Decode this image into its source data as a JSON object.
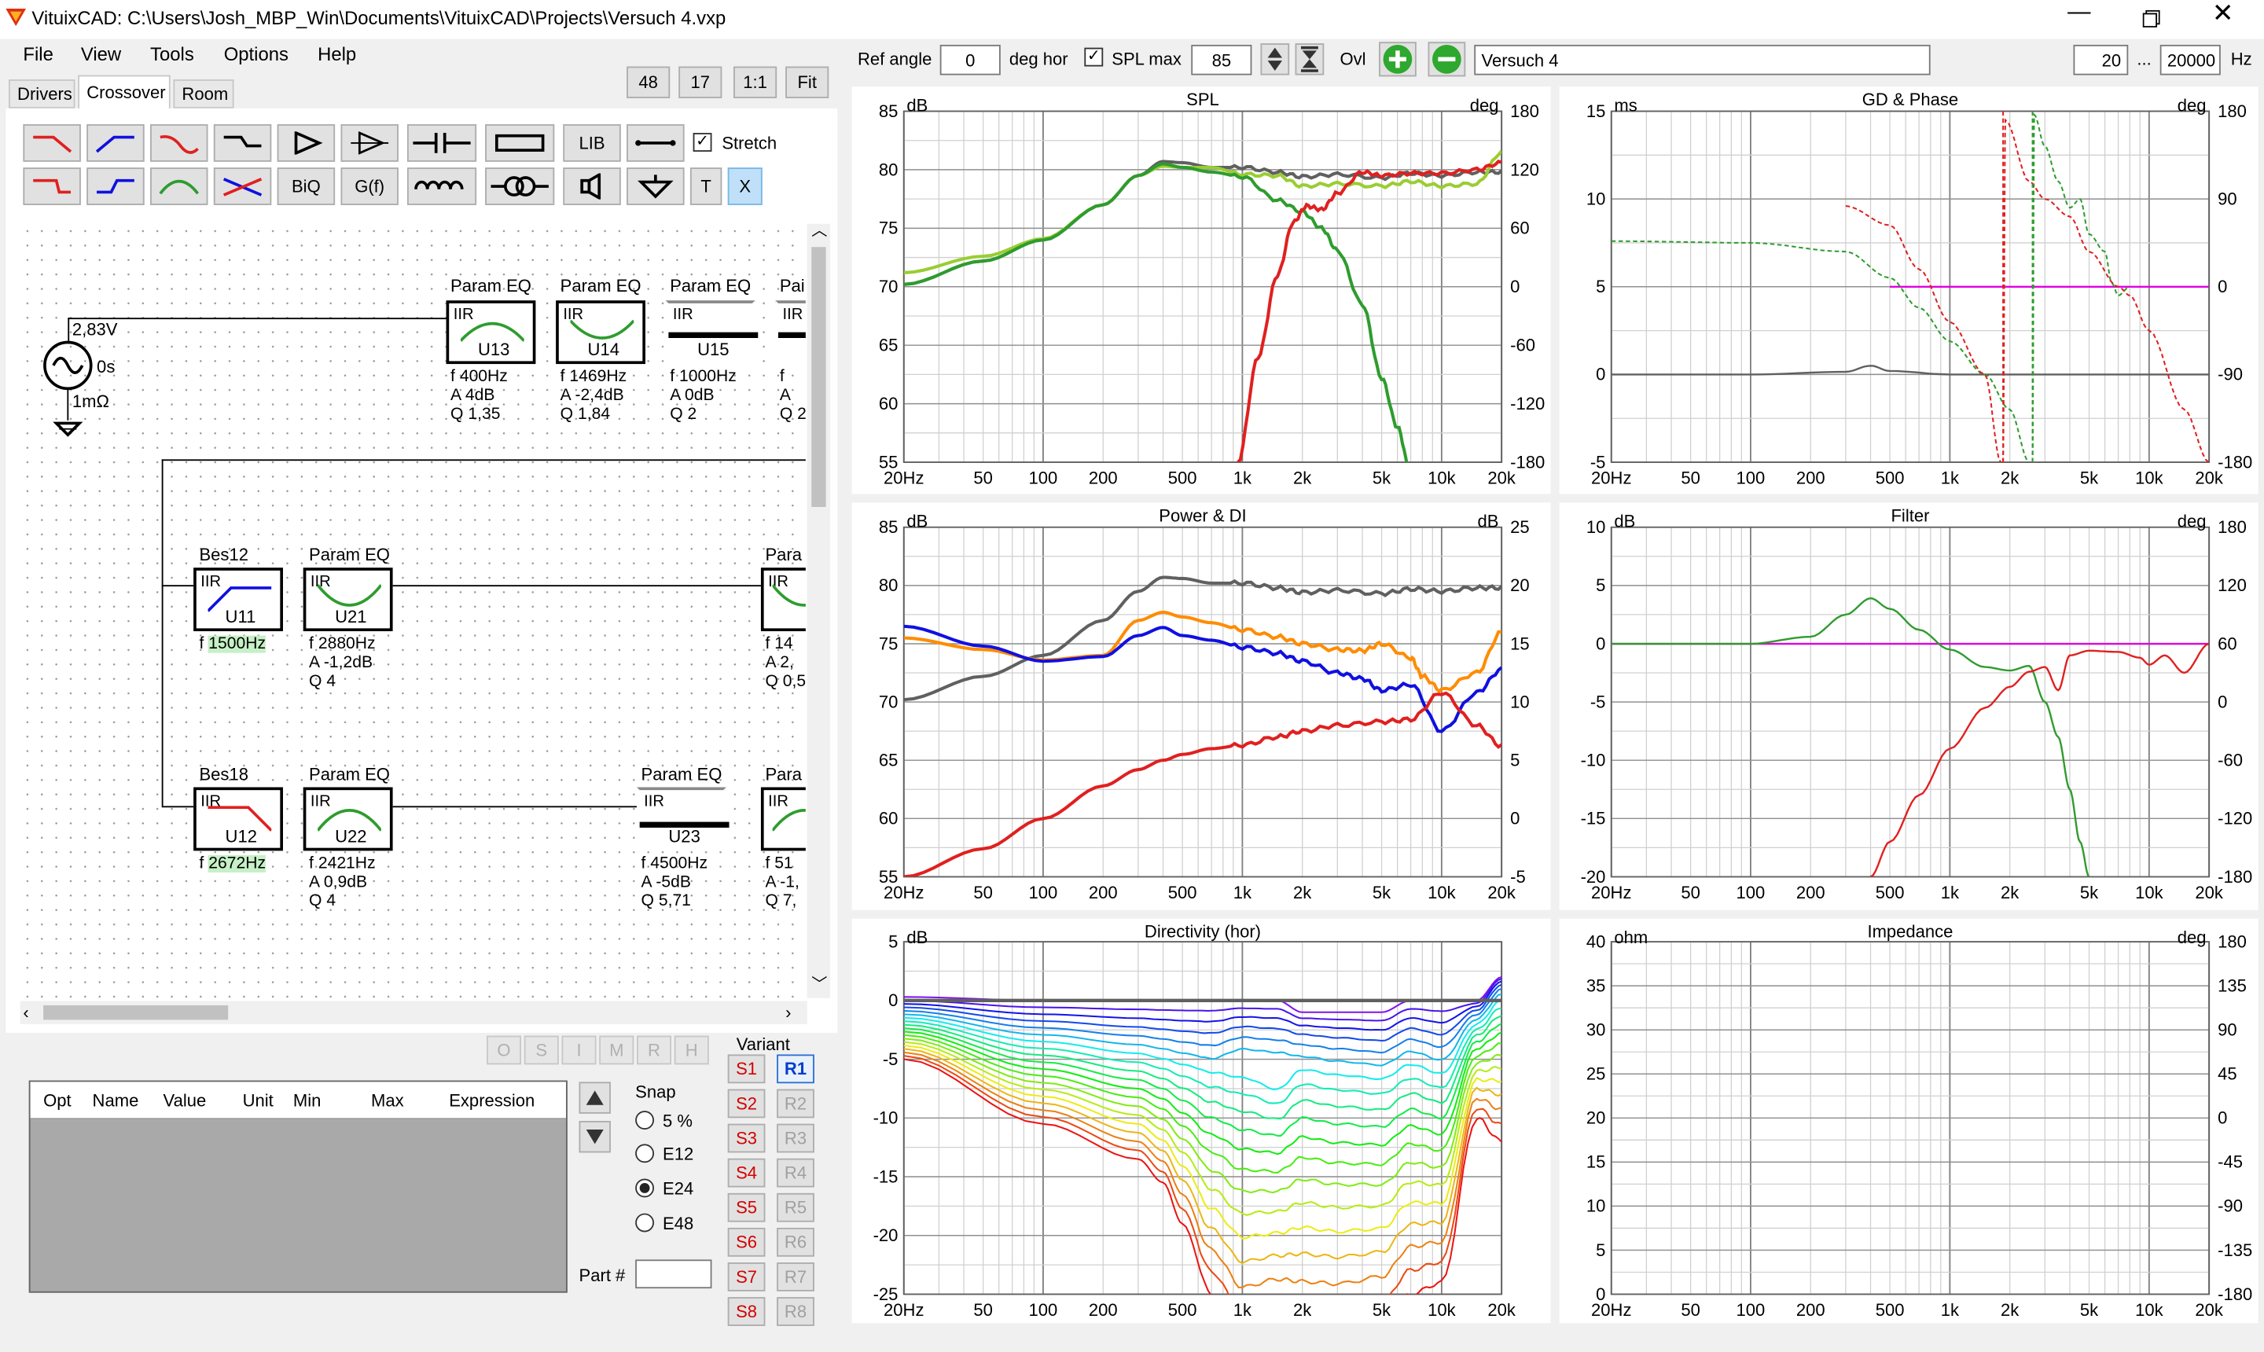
{
  "title": "VituixCAD: C:\\Users\\Josh_MBP_Win\\Documents\\VituixCAD\\Projects\\Versuch 4.vxp",
  "menu": [
    "File",
    "View",
    "Tools",
    "Options",
    "Help"
  ],
  "zoom_buttons": [
    "48",
    "17",
    "1:1",
    "Fit"
  ],
  "tabs": [
    "Drivers",
    "Crossover",
    "Room"
  ],
  "toolbar": {
    "lib": "LIB",
    "stretch": "Stretch",
    "biq": "BiQ",
    "gf": "G(f)",
    "t": "T",
    "x": "X"
  },
  "source": {
    "voltage": "2,83V",
    "delay": "0s",
    "resistance": "1mΩ"
  },
  "blocks": [
    {
      "title": "Param EQ",
      "type": "IIR",
      "id": "U13",
      "f": "400Hz",
      "a": "4dB",
      "q": "1,35"
    },
    {
      "title": "Param EQ",
      "type": "IIR",
      "id": "U14",
      "f": "1469Hz",
      "a": "-2,4dB",
      "q": "1,84"
    },
    {
      "title": "Param EQ",
      "type": "IIR",
      "id": "U15",
      "f": "1000Hz",
      "a": "0dB",
      "q": "2"
    },
    {
      "title": "Bes12",
      "type": "IIR",
      "id": "U11",
      "f": "1500Hz"
    },
    {
      "title": "Param EQ",
      "type": "IIR",
      "id": "U21",
      "f": "2880Hz",
      "a": "-1,2dB",
      "q": "4"
    },
    {
      "title": "Bes18",
      "type": "IIR",
      "id": "U12",
      "f": "2672Hz"
    },
    {
      "title": "Param EQ",
      "type": "IIR",
      "id": "U22",
      "f": "2421Hz",
      "a": "0,9dB",
      "q": "4"
    },
    {
      "title": "Param EQ",
      "type": "IIR",
      "id": "U23",
      "f": "4500Hz",
      "a": "-5dB",
      "q": "5,71"
    }
  ],
  "partial_blocks": [
    {
      "title": "Pai",
      "f": "f",
      "a": "A",
      "q": "Q 2"
    },
    {
      "title": "Para",
      "f": "f  14",
      "a": "A  2,",
      "q": "Q 0,5"
    },
    {
      "title": "Para",
      "f": "f  51",
      "a": "A  -1,",
      "q": "Q 7,"
    }
  ],
  "labels_f": "f",
  "labels_a": "A",
  "labels_q": "Q",
  "osim": [
    "O",
    "S",
    "I",
    "M",
    "R",
    "H"
  ],
  "table_headers": [
    "Opt",
    "Name",
    "Value",
    "Unit",
    "Min",
    "Max",
    "Expression"
  ],
  "snap": {
    "label": "Snap",
    "options": [
      "5 %",
      "E12",
      "E24",
      "E48"
    ],
    "selected": "E24"
  },
  "part_label": "Part #",
  "variant": {
    "label": "Variant",
    "s": [
      "S1",
      "S2",
      "S3",
      "S4",
      "S5",
      "S6",
      "S7",
      "S8"
    ],
    "r": [
      "R1",
      "R2",
      "R3",
      "R4",
      "R5",
      "R6",
      "R7",
      "R8"
    ]
  },
  "top": {
    "ref_angle_label": "Ref angle",
    "ref_angle": "0",
    "deg_hor": "deg hor",
    "spl_max_label": "SPL max",
    "spl_max": "85",
    "ovl": "Ovl",
    "project": "Versuch 4",
    "f_min": "20",
    "dots": "...",
    "f_max": "20000",
    "hz": "Hz"
  },
  "xticks": [
    "20Hz",
    "50",
    "100",
    "200",
    "500",
    "1k",
    "2k",
    "5k",
    "10k",
    "20k"
  ],
  "colors": {
    "dark_gray": "#606060",
    "light_green": "#9acd32",
    "green": "#2e9c2e",
    "red": "#e02020",
    "orange": "#ff8c00",
    "blue": "#1010e0",
    "magenta": "#e000e0"
  },
  "chart_data": [
    {
      "type": "line",
      "title": "SPL",
      "ylabel": "dB",
      "y2label": "deg",
      "ylim": [
        55,
        85
      ],
      "y2lim": [
        -180,
        180
      ],
      "yticks": [
        "85",
        "80",
        "75",
        "70",
        "65",
        "60",
        "55"
      ],
      "y2ticks": [
        "180",
        "120",
        "60",
        "0",
        "-60",
        "-120",
        "-180"
      ],
      "series": [
        {
          "color": "#606060",
          "x": [
            20,
            50,
            100,
            200,
            300,
            400,
            500,
            700,
            1000,
            1500,
            2000,
            3000,
            5000,
            7000,
            10000,
            15000,
            20000
          ],
          "y": [
            70.2,
            72.2,
            74,
            77,
            79.5,
            80.7,
            80.6,
            80.2,
            80.2,
            79.8,
            79.4,
            79.6,
            79.3,
            79.7,
            79.5,
            79.8,
            79.8
          ]
        },
        {
          "color": "#9acd32",
          "x": [
            20,
            50,
            100,
            200,
            300,
            400,
            500,
            700,
            1000,
            1500,
            2000,
            3000,
            5000,
            7000,
            10000,
            15000,
            20000
          ],
          "y": [
            71.2,
            72.6,
            74.1,
            77,
            79.5,
            80.3,
            80.2,
            80.2,
            79.6,
            79.5,
            78.6,
            78.8,
            78.6,
            79,
            78.6,
            78.8,
            81.5
          ]
        },
        {
          "color": "#2e9c2e",
          "x": [
            20,
            50,
            100,
            200,
            300,
            400,
            500,
            700,
            1000,
            1500,
            2000,
            2500,
            3000,
            4000,
            5000,
            6000,
            7000
          ],
          "y": [
            70.2,
            72.2,
            74,
            77,
            79.5,
            80.5,
            80.2,
            79.8,
            79.4,
            77.4,
            76.4,
            75,
            73.1,
            68.5,
            62.2,
            58,
            54
          ]
        },
        {
          "color": "#e02020",
          "x": [
            950,
            1200,
            1500,
            1800,
            2100,
            2500,
            3000,
            4000,
            5000,
            7000,
            10000,
            15000,
            20000
          ],
          "y": [
            55,
            64,
            71,
            75.5,
            76.9,
            76.6,
            78,
            79.8,
            79.5,
            79.7,
            79.7,
            80,
            80.6
          ]
        }
      ]
    },
    {
      "type": "line",
      "title": "GD & Phase",
      "ylabel": "ms",
      "y2label": "deg",
      "ylim": [
        -5,
        15
      ],
      "y2lim": [
        -180,
        180
      ],
      "yticks": [
        "15",
        "10",
        "5",
        "0",
        "-5"
      ],
      "y2ticks": [
        "180",
        "90",
        "0",
        "-90",
        "-180"
      ],
      "series": [
        {
          "color": "#606060",
          "x": [
            20,
            100,
            300,
            400,
            500,
            1000,
            2000,
            5000,
            10000,
            20000
          ],
          "y": [
            0,
            0,
            0.15,
            0.5,
            0.2,
            0,
            0,
            0,
            0,
            0
          ]
        },
        {
          "color": "#e000e0",
          "x": [
            500,
            20000
          ],
          "y": [
            5,
            5
          ]
        },
        {
          "color": "#2e9c2e",
          "dash": true,
          "x": [
            20,
            100,
            300,
            500,
            700,
            1000,
            1500,
            2000,
            2500
          ],
          "y": [
            7.6,
            7.5,
            7,
            5.5,
            3.8,
            1.9,
            0,
            -2,
            -5
          ]
        },
        {
          "color": "#2e9c2e",
          "dash": true,
          "x": [
            2600,
            2650,
            3000,
            3500,
            4000,
            4500,
            5000,
            6000,
            6500,
            7000,
            8000
          ],
          "y": [
            -5,
            14.8,
            13,
            11,
            9.5,
            10,
            8,
            7,
            5.2,
            4.5,
            5
          ]
        },
        {
          "color": "#e02020",
          "dash": true,
          "x": [
            300,
            500,
            700,
            1000,
            1500,
            1800
          ],
          "y": [
            9.6,
            8.5,
            6,
            3,
            0,
            -5
          ]
        },
        {
          "color": "#e02020",
          "dash": true,
          "x": [
            1850,
            1900,
            2500,
            3000,
            4000,
            5000,
            7000,
            8000,
            10000,
            15000,
            20000
          ],
          "y": [
            -5,
            14.5,
            11,
            10,
            9,
            7,
            5,
            4.5,
            2.5,
            -2,
            -5
          ]
        }
      ]
    },
    {
      "type": "line",
      "title": "Power & DI",
      "ylabel": "dB",
      "y2label": "dB",
      "ylim": [
        55,
        85
      ],
      "y2lim": [
        -5,
        25
      ],
      "yticks": [
        "85",
        "80",
        "75",
        "70",
        "65",
        "60",
        "55"
      ],
      "y2ticks": [
        "25",
        "20",
        "15",
        "10",
        "5",
        "0",
        "-5"
      ],
      "series": [
        {
          "color": "#606060",
          "x": [
            20,
            50,
            100,
            200,
            300,
            400,
            500,
            700,
            1000,
            1500,
            2000,
            3000,
            5000,
            7000,
            10000,
            15000,
            20000
          ],
          "y": [
            70.2,
            72.2,
            74,
            77,
            79.5,
            80.7,
            80.6,
            80.2,
            80.2,
            79.8,
            79.4,
            79.6,
            79.3,
            79.7,
            79.5,
            79.8,
            79.8
          ]
        },
        {
          "color": "#ff8c00",
          "x": [
            20,
            50,
            100,
            200,
            300,
            400,
            500,
            700,
            1000,
            1500,
            2000,
            3000,
            4000,
            5000,
            7000,
            8000,
            10000,
            15000,
            20000
          ],
          "y": [
            75.5,
            74.5,
            73.6,
            74,
            77,
            77.7,
            77.3,
            76.8,
            76.2,
            75.6,
            75,
            74.5,
            74.4,
            75,
            73.8,
            72.2,
            71,
            72.5,
            76
          ]
        },
        {
          "color": "#1010e0",
          "x": [
            20,
            50,
            100,
            200,
            300,
            400,
            500,
            700,
            1000,
            1500,
            2000,
            3000,
            4000,
            5000,
            7000,
            10000,
            15000,
            20000
          ],
          "y": [
            76.5,
            74.8,
            73.5,
            73.9,
            75.7,
            76.4,
            75.7,
            75.3,
            74.7,
            74.2,
            73.5,
            72.5,
            72,
            71,
            71.5,
            67.5,
            70.8,
            72.8
          ]
        },
        {
          "color": "#e02020",
          "x": [
            20,
            50,
            100,
            200,
            300,
            400,
            500,
            700,
            1000,
            1500,
            2000,
            3000,
            5000,
            7000,
            10000,
            15000,
            20000
          ],
          "y": [
            55,
            57.4,
            60,
            62.8,
            64.2,
            65,
            65.5,
            66,
            66.3,
            67,
            67.5,
            68,
            68.3,
            68.5,
            70.8,
            68,
            66.2
          ]
        }
      ]
    },
    {
      "type": "line",
      "title": "Filter",
      "ylabel": "dB",
      "y2label": "deg",
      "ylim": [
        -20,
        10
      ],
      "y2lim": [
        -180,
        180
      ],
      "yticks": [
        "10",
        "5",
        "0",
        "-5",
        "-10",
        "-15",
        "-20"
      ],
      "y2ticks": [
        "180",
        "120",
        "60",
        "0",
        "-60",
        "-120",
        "-180"
      ],
      "series": [
        {
          "color": "#e000e0",
          "x": [
            20,
            20000
          ],
          "y": [
            0,
            0
          ]
        },
        {
          "color": "#2e9c2e",
          "x": [
            20,
            100,
            200,
            300,
            400,
            500,
            700,
            1000,
            1500,
            2000,
            2500,
            3000,
            3500,
            4000,
            4500,
            5000
          ],
          "y": [
            0,
            0,
            0.6,
            2.5,
            3.9,
            3,
            1.2,
            -0.5,
            -2,
            -2.3,
            -1.9,
            -5,
            -8,
            -12.5,
            -17,
            -20
          ]
        },
        {
          "color": "#e02020",
          "x": [
            400,
            500,
            700,
            1000,
            1500,
            2000,
            2500,
            3000,
            3500,
            4000,
            5000,
            7000,
            9000,
            10000,
            12000,
            15000,
            20000
          ],
          "y": [
            -20,
            -17,
            -13,
            -9,
            -5.5,
            -3.7,
            -2.4,
            -2,
            -4,
            -1,
            -0.6,
            -0.7,
            -1.2,
            -1.8,
            -1,
            -2.5,
            0
          ]
        }
      ]
    },
    {
      "type": "line",
      "title": "Directivity (hor)",
      "ylabel": "dB",
      "ylim": [
        -25,
        5
      ],
      "yticks": [
        "5",
        "0",
        "-5",
        "-10",
        "-15",
        "-20",
        "-25"
      ]
    },
    {
      "type": "line",
      "title": "Impedance",
      "ylabel": "ohm",
      "y2label": "deg",
      "ylim": [
        0,
        40
      ],
      "y2lim": [
        -180,
        180
      ],
      "yticks": [
        "40",
        "35",
        "30",
        "25",
        "20",
        "15",
        "10",
        "5",
        "0"
      ],
      "y2ticks": [
        "180",
        "135",
        "90",
        "45",
        "0",
        "-45",
        "-90",
        "-135",
        "-180"
      ],
      "series": []
    }
  ]
}
